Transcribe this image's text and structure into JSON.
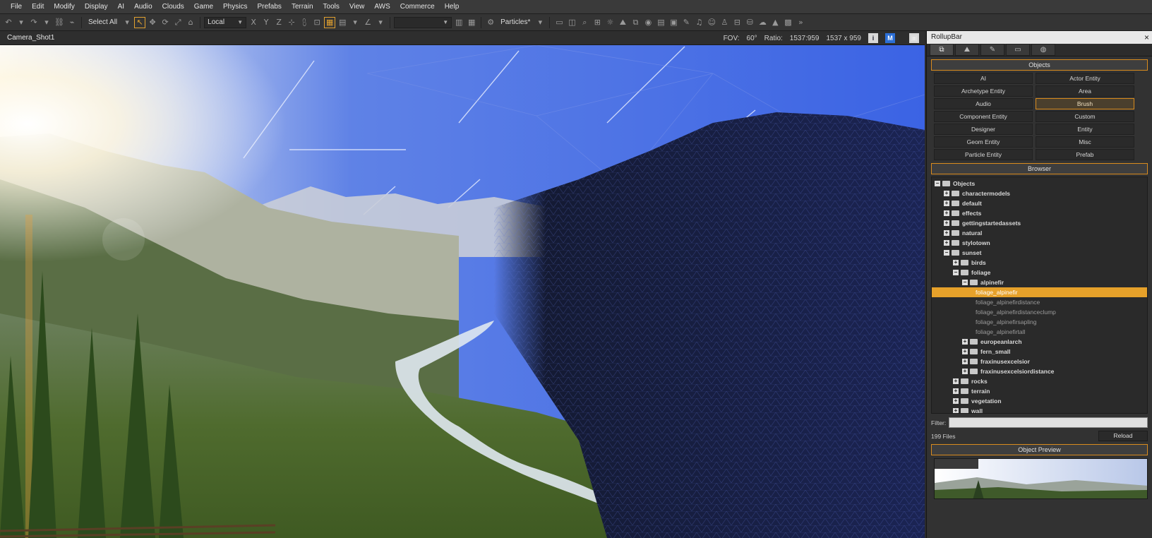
{
  "menu": [
    "File",
    "Edit",
    "Modify",
    "Display",
    "AI",
    "Audio",
    "Clouds",
    "Game",
    "Physics",
    "Prefabs",
    "Terrain",
    "Tools",
    "View",
    "AWS",
    "Commerce",
    "Help"
  ],
  "toolbar": {
    "select_mode": "Select All",
    "coord_space": "Local",
    "particles_label": "Particles*"
  },
  "viewport": {
    "camera_name": "Camera_Shot1",
    "fov_label": "FOV:",
    "fov_value": "60°",
    "ratio_label": "Ratio:",
    "ratio_value": "1537:959",
    "resolution": "1537 x 959",
    "btn_info": "i",
    "btn_blue": "M",
    "btn_cam": "▣"
  },
  "rollupbar": {
    "title": "RollupBar",
    "close": "×",
    "tabs": [
      "⧉",
      "⛰",
      "✎",
      "▭",
      "◍"
    ],
    "objects_header": "Objects",
    "objects": [
      "AI",
      "Actor Entity",
      "Archetype Entity",
      "Area",
      "Audio",
      "Brush",
      "Component Entity",
      "Custom",
      "Designer",
      "Entity",
      "Geom Entity",
      "Misc",
      "Particle Entity",
      "Prefab"
    ],
    "selected_object": "Brush",
    "browser_header": "Browser",
    "tree": [
      {
        "label": "Objects",
        "depth": 0,
        "type": "folder",
        "exp": "−"
      },
      {
        "label": "charactermodels",
        "depth": 1,
        "type": "folder",
        "exp": "+"
      },
      {
        "label": "default",
        "depth": 1,
        "type": "folder",
        "exp": "+"
      },
      {
        "label": "effects",
        "depth": 1,
        "type": "folder",
        "exp": "+"
      },
      {
        "label": "gettingstartedassets",
        "depth": 1,
        "type": "folder",
        "exp": "+"
      },
      {
        "label": "natural",
        "depth": 1,
        "type": "folder",
        "exp": "+"
      },
      {
        "label": "stylotown",
        "depth": 1,
        "type": "folder",
        "exp": "+"
      },
      {
        "label": "sunset",
        "depth": 1,
        "type": "folder",
        "exp": "−"
      },
      {
        "label": "birds",
        "depth": 2,
        "type": "folder",
        "exp": "+"
      },
      {
        "label": "foliage",
        "depth": 2,
        "type": "folder",
        "exp": "−"
      },
      {
        "label": "alpinefir",
        "depth": 3,
        "type": "folder",
        "exp": "−"
      },
      {
        "label": "foliage_alpinefir",
        "depth": 4,
        "type": "leaf",
        "selected": true
      },
      {
        "label": "foliage_alpinefirdistance",
        "depth": 4,
        "type": "leaf"
      },
      {
        "label": "foliage_alpinefirdistanceclump",
        "depth": 4,
        "type": "leaf"
      },
      {
        "label": "foliage_alpinefirsapling",
        "depth": 4,
        "type": "leaf"
      },
      {
        "label": "foliage_alpinefirtall",
        "depth": 4,
        "type": "leaf"
      },
      {
        "label": "europeanlarch",
        "depth": 3,
        "type": "folder",
        "exp": "+"
      },
      {
        "label": "fern_small",
        "depth": 3,
        "type": "folder",
        "exp": "+"
      },
      {
        "label": "fraxinusexcelsior",
        "depth": 3,
        "type": "folder",
        "exp": "+"
      },
      {
        "label": "fraxinusexcelsiordistance",
        "depth": 3,
        "type": "folder",
        "exp": "+"
      },
      {
        "label": "rocks",
        "depth": 2,
        "type": "folder",
        "exp": "+"
      },
      {
        "label": "terrain",
        "depth": 2,
        "type": "folder",
        "exp": "+"
      },
      {
        "label": "vegetation",
        "depth": 2,
        "type": "folder",
        "exp": "+"
      },
      {
        "label": "wall",
        "depth": 2,
        "type": "folder",
        "exp": "+"
      }
    ],
    "filter_label": "Filter:",
    "filter_value": "",
    "files_count": "199 Files",
    "reload_label": "Reload",
    "preview_header": "Object Preview"
  },
  "colors": {
    "accent": "#d98b1e",
    "selection": "#e6a12a",
    "sky": "#3b5fc8"
  }
}
